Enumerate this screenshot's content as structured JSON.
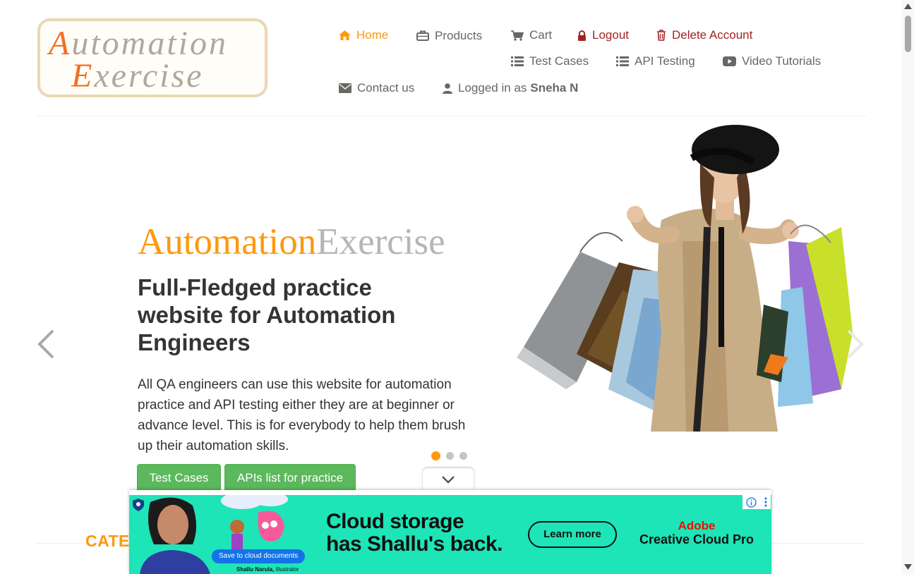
{
  "logo": {
    "line1_cap": "A",
    "line1_rest": "utomation",
    "line2_cap": "E",
    "line2_rest": "xercise"
  },
  "nav": {
    "home": "Home",
    "products": "Products",
    "cart": "Cart",
    "logout": "Logout",
    "delete_account": "Delete Account",
    "test_cases": "Test Cases",
    "api_testing": "API Testing",
    "video_tutorials": "Video Tutorials",
    "contact_us": "Contact us",
    "logged_in_prefix": "Logged in as",
    "logged_in_user": "Sneha N"
  },
  "slider": {
    "brand_a": "Automation",
    "brand_b": "Exercise",
    "heading": "Full-Fledged practice website for Automation Engineers",
    "text": "All QA engineers can use this website for automation practice and API testing either they are at beginner or advance level. This is for everybody to help them brush up their automation skills.",
    "btn_test_cases": "Test Cases",
    "btn_apis": "APIs list for practice",
    "active_slide": 1,
    "slide_count": 3
  },
  "category": {
    "title": "CATEGORY"
  },
  "ad": {
    "headline_1": "Cloud storage",
    "headline_2": "has Shallu's back.",
    "cta": "Learn more",
    "brand_1": "Adobe",
    "brand_2": "Creative Cloud Pro",
    "pill": "Save to cloud documents",
    "credit_name": "Shallu Narula,",
    "credit_role": "Illustrator"
  },
  "colors": {
    "accent": "#fe980f",
    "text": "#696763",
    "danger": "#a32323",
    "button": "#5cb85c",
    "ad_bg": "#1de5b8"
  }
}
